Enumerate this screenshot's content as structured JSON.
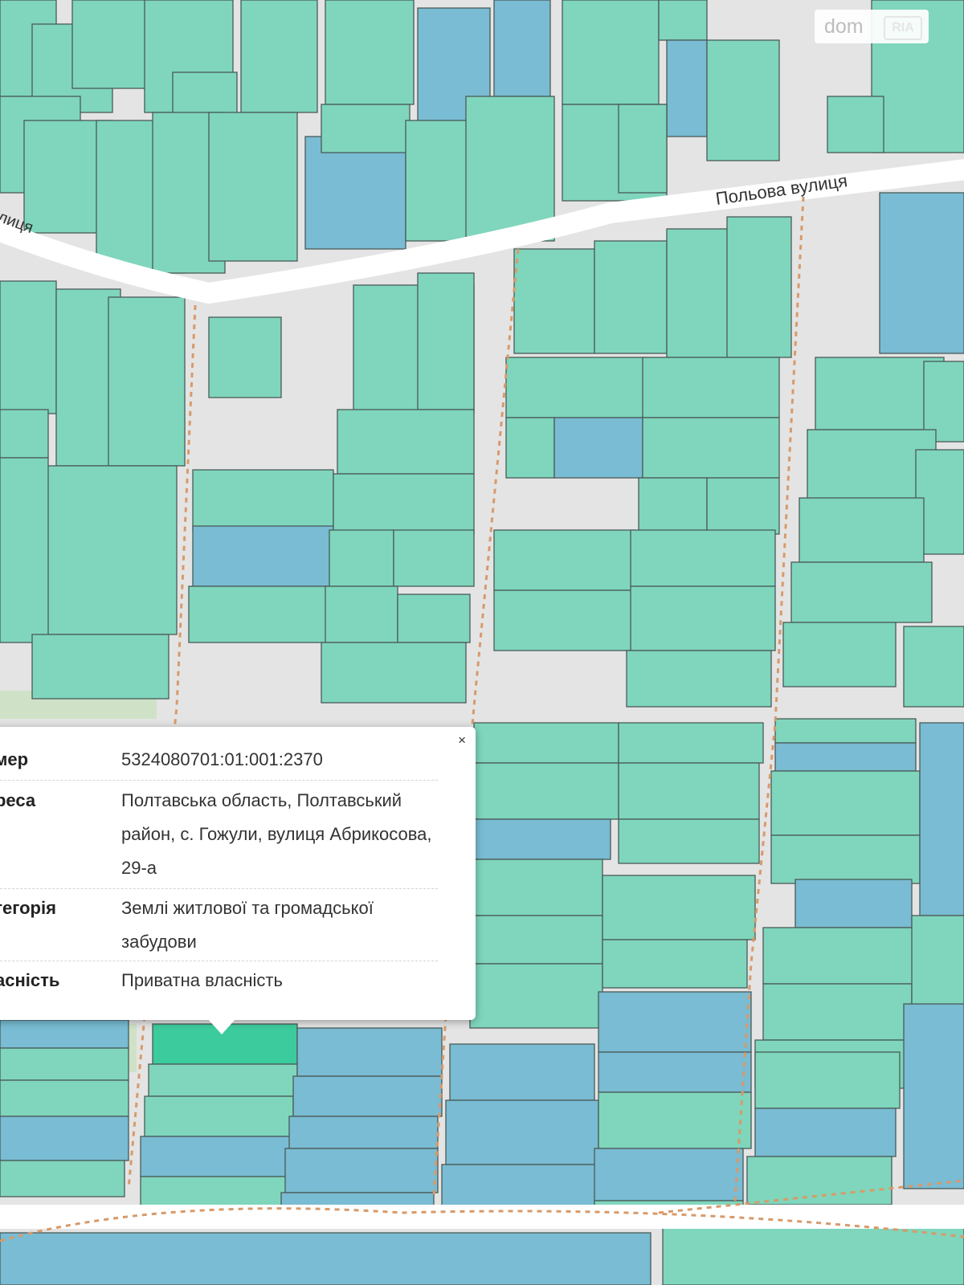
{
  "map": {
    "street_label": "Польова вулиця",
    "street_label_left": "лиця",
    "colors": {
      "background": "#e4e4e4",
      "road": "#ffffff",
      "parcel_green": "#7fd6bc",
      "parcel_blue": "#79bcd3",
      "parcel_selected": "#3ccb9c",
      "parcel_border": "#4b5a58",
      "path": "#d79a6a",
      "park": "#cfe2c8"
    }
  },
  "logo": {
    "dom": "dom",
    "ria": "RIA"
  },
  "popup": {
    "close_label": "×",
    "rows": [
      {
        "key": "омер",
        "value": "5324080701:01:001:2370"
      },
      {
        "key": "дреса",
        "value": "Полтавська область, Полтавський район, с. Гожули, вулиця Абрикосова, 29-а"
      },
      {
        "key": "атегорія",
        "value": "Землі житлової та громадської забудови"
      },
      {
        "key": "ласність",
        "value": "Приватна власність"
      }
    ]
  }
}
